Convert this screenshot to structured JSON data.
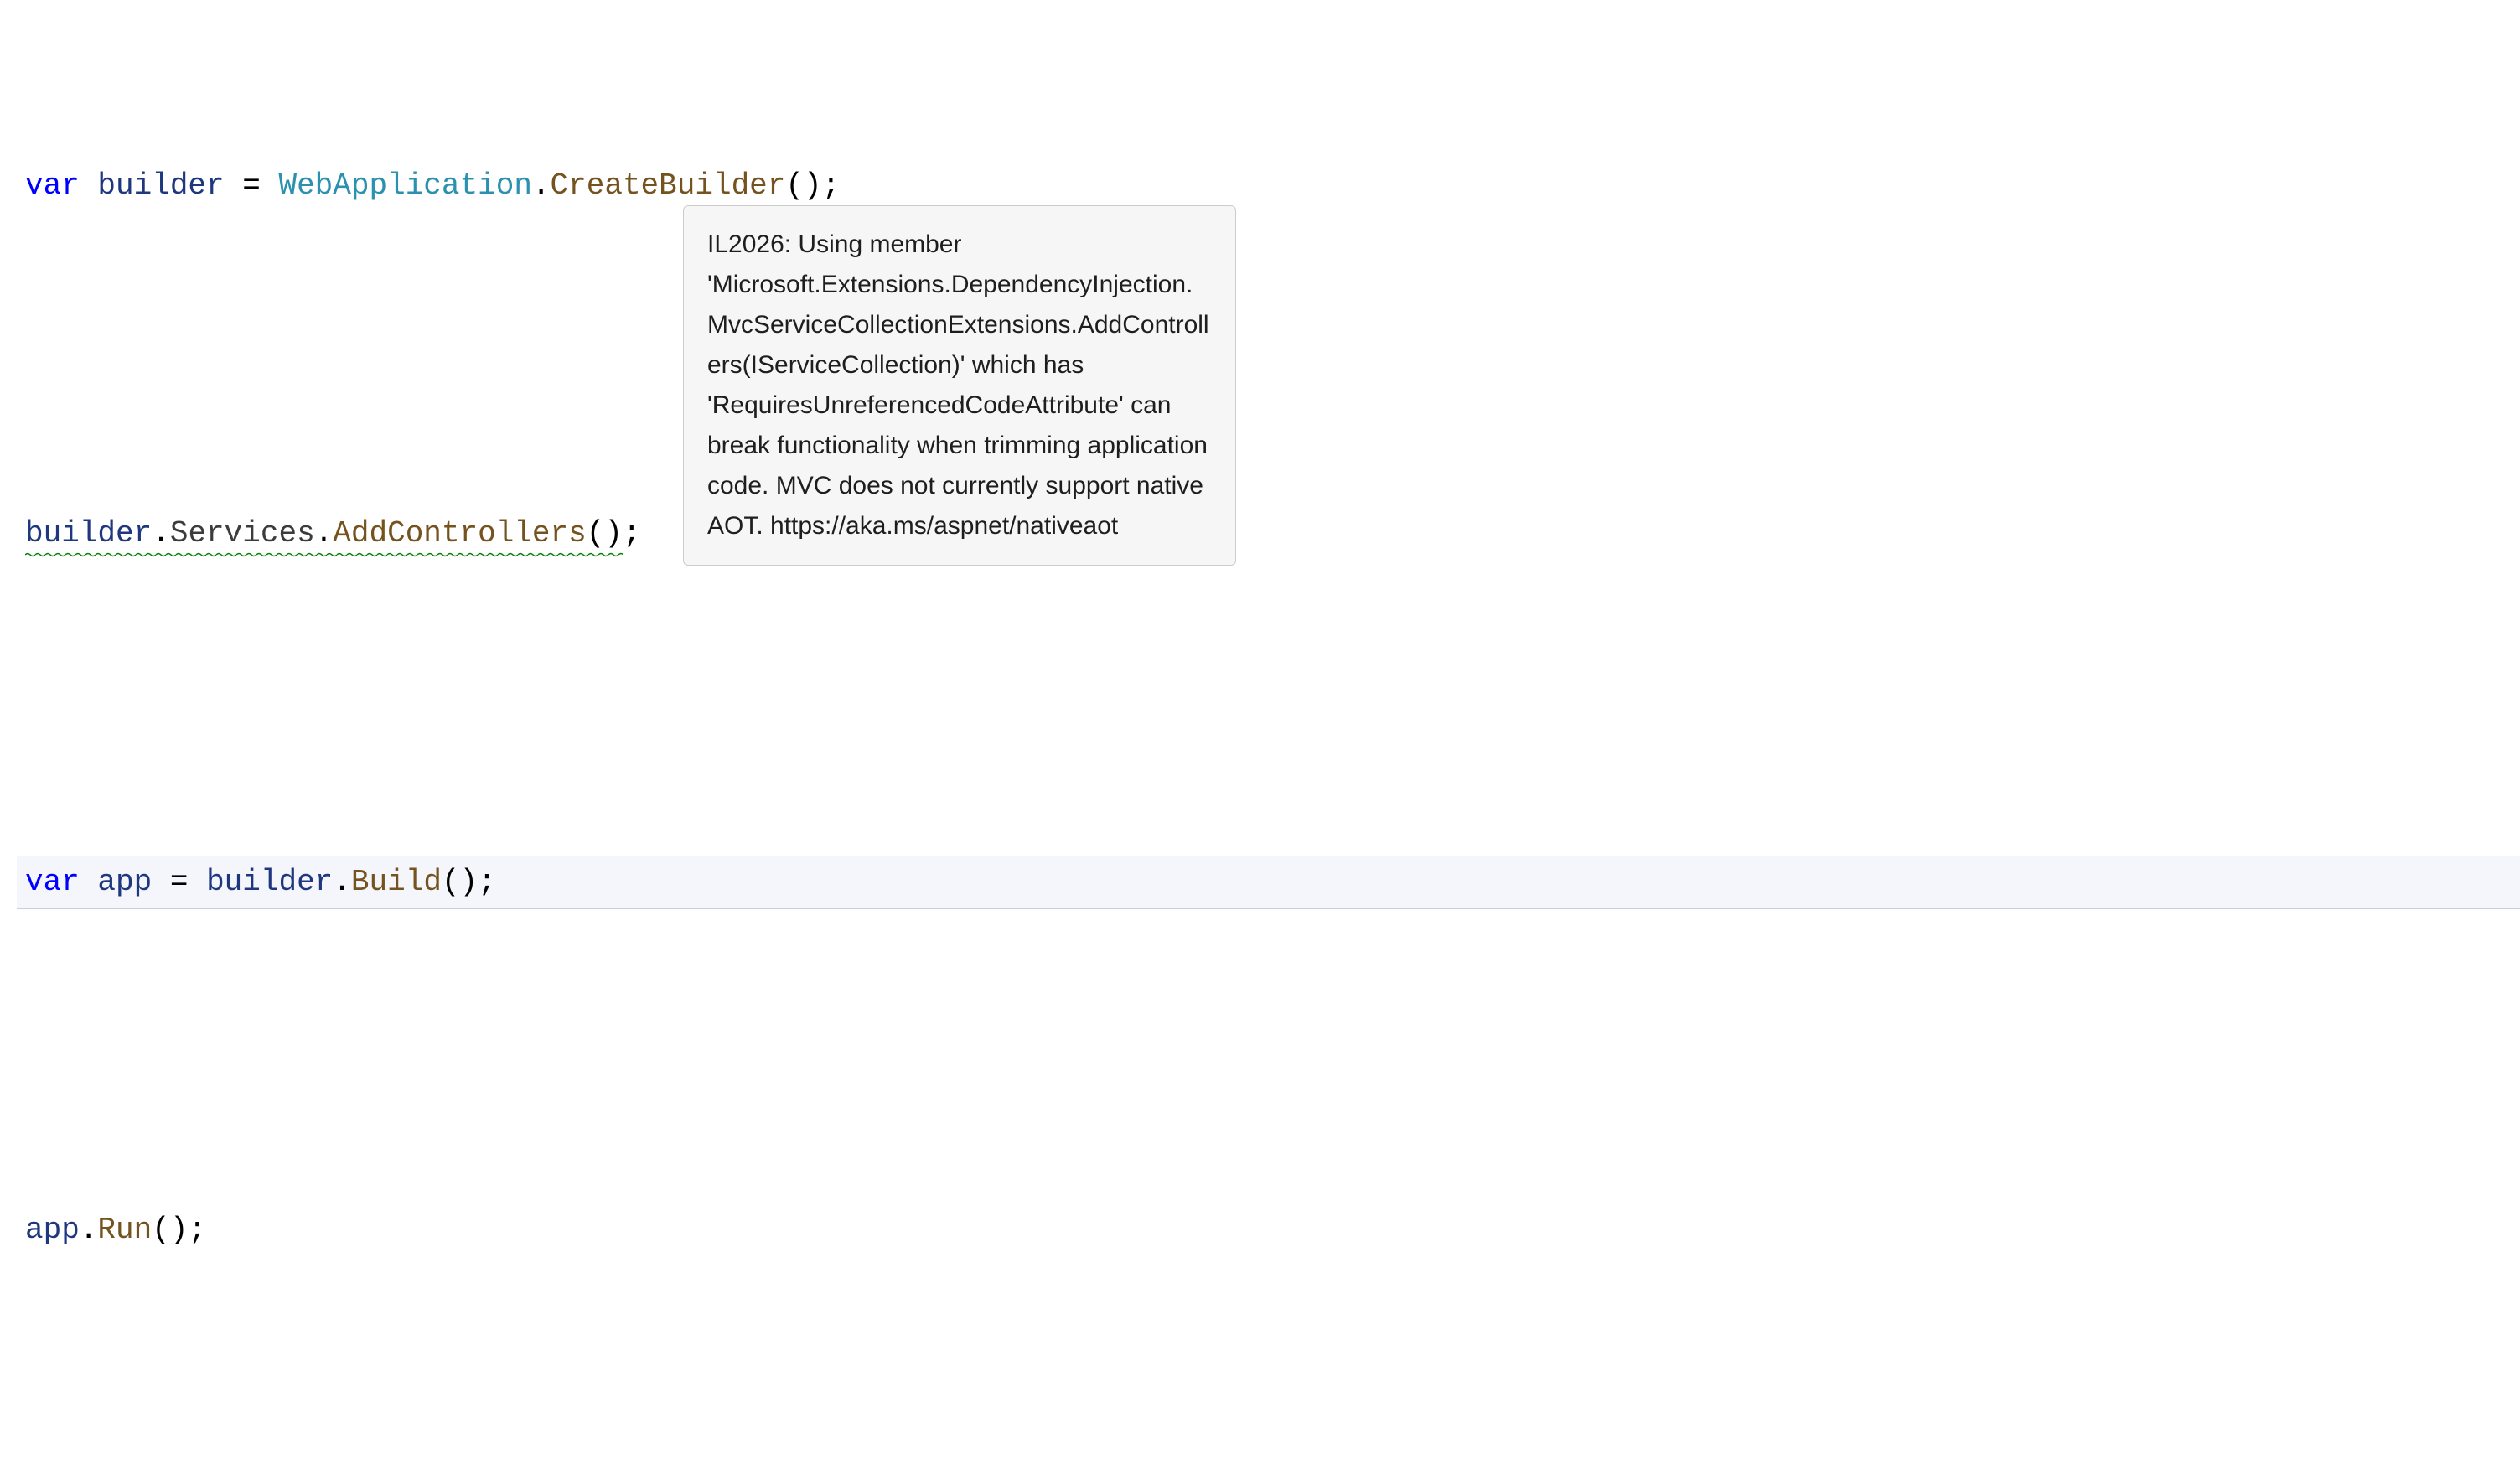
{
  "code": {
    "line1": {
      "kw_var": "var",
      "ident_builder": " builder ",
      "eq": "= ",
      "type_webapp": "WebApplication",
      "dot1": ".",
      "method_create": "CreateBuilder",
      "parens_semi": "();"
    },
    "line2": {
      "ident_builder": "builder",
      "dot1": ".",
      "member_services": "Services",
      "dot2": ".",
      "method_addctrl": "AddControllers",
      "parens": "()",
      "semi": ";"
    },
    "line3": {
      "kw_var": "var",
      "ident_app": " app ",
      "eq": "= ",
      "ident_builder": "builder",
      "dot1": ".",
      "method_build": "Build",
      "parens_semi": "();"
    },
    "line4": {
      "ident_app": "app",
      "dot1": ".",
      "method_run": "Run",
      "parens_semi": "();"
    }
  },
  "tooltip": {
    "message": "IL2026: Using member 'Microsoft.Extensions.DependencyInjection.MvcServiceCollectionExtensions.AddControllers(IServiceCollection)' which has 'RequiresUnreferencedCodeAttribute' can break functionality when trimming application code. MVC does not currently support native AOT. https://aka.ms/aspnet/nativeaot"
  }
}
